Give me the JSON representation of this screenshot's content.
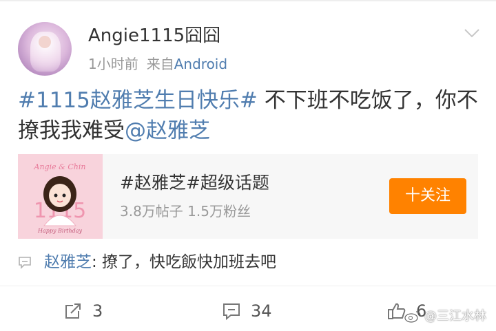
{
  "post": {
    "username": "Angie1115囧囧",
    "time": "1小时前",
    "source_prefix": "来自",
    "source": "Android",
    "topic_tag": "#1115赵雅芝生日快乐#",
    "text_part1": " 不下班不吃饭了，你不撩我我难受",
    "mention": "@赵雅芝"
  },
  "topic_card": {
    "title": "#赵雅芝#超级话题",
    "stats": "3.8万帖子 1.5万粉丝",
    "follow_label": "十关注",
    "image_text_top": "Angie & Chin",
    "image_number": "1115",
    "image_caption": "Happy Birthday"
  },
  "comment": {
    "author": "赵雅芝",
    "text": ": 撩了，快吃飯快加班去吧"
  },
  "actions": {
    "repost_count": "3",
    "comment_count": "34",
    "like_count": "6"
  },
  "watermark": {
    "text": "@三江水林"
  },
  "colors": {
    "link": "#507daf",
    "follow_button": "#ff8200",
    "card_bg": "#f7f7f7",
    "meta_text": "#999999"
  },
  "icons": {
    "more": "chevron-down-icon",
    "repost": "repost-icon",
    "comment": "comment-icon",
    "like": "thumbs-up-icon"
  }
}
